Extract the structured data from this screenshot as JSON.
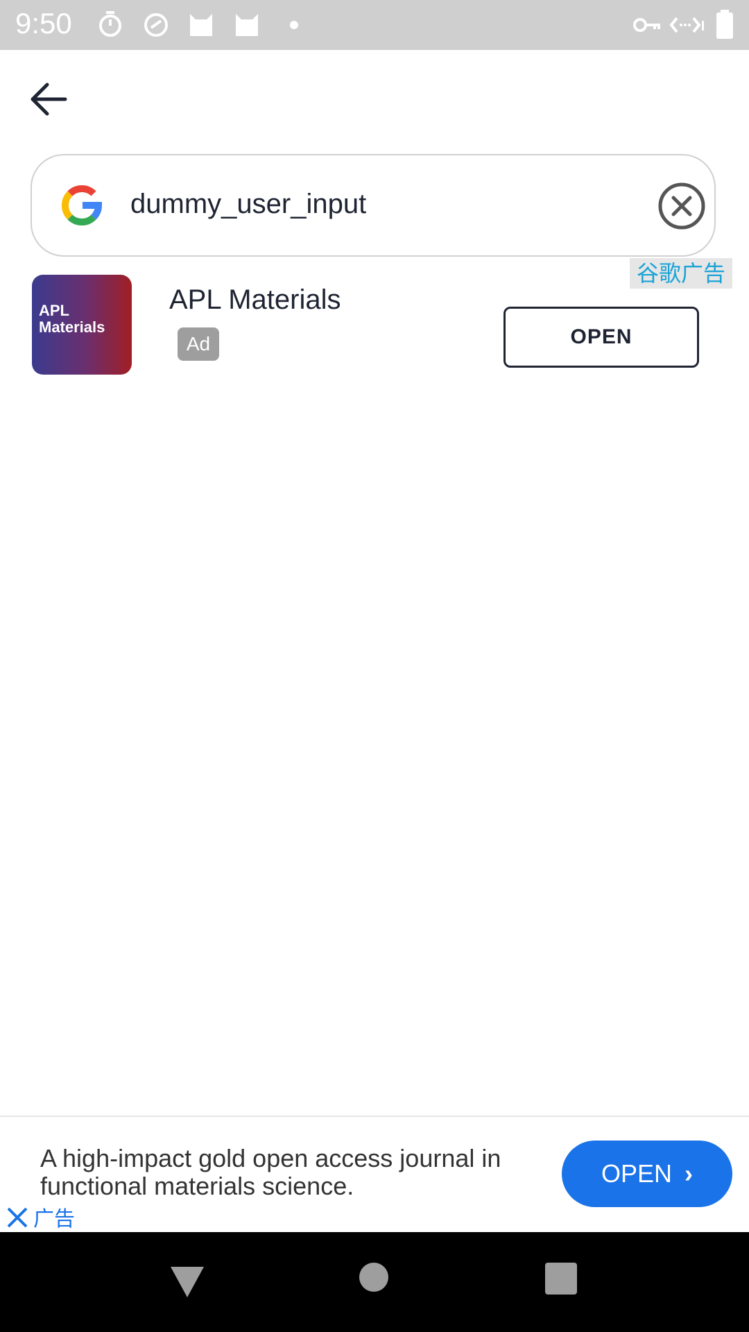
{
  "status_bar": {
    "time": "9:50",
    "icons": [
      "timer-icon",
      "speedometer-icon",
      "cat-icon",
      "cat-icon",
      "dot-icon",
      "vpn-key-icon",
      "data-arrows-icon",
      "battery-icon"
    ]
  },
  "header": {
    "back_icon": "arrow-left-icon"
  },
  "search": {
    "value": "dummy_user_input",
    "clear_icon": "close-circle-icon",
    "logo": "google-g-icon"
  },
  "ads_badge": {
    "label": "谷歌广告"
  },
  "result": {
    "icon_text_line1": "APL",
    "icon_text_line2": "Materials",
    "title": "APL Materials",
    "ad_label": "Ad",
    "open_label": "OPEN"
  },
  "banner": {
    "text": "A high-impact gold open access journal in functional materials science.",
    "open_label": "OPEN",
    "ad_label": "广告",
    "close_icon": "close-x-icon"
  },
  "colors": {
    "accent_blue": "#1a73e8",
    "ad_label_color": "#1aa3d6",
    "dark_text": "#1f2433",
    "status_bar_bg": "#cfcfcf"
  }
}
